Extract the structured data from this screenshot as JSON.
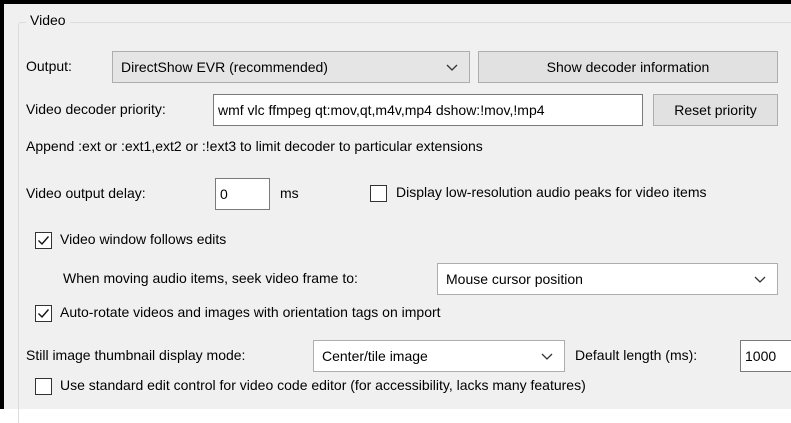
{
  "group": {
    "title": "Video"
  },
  "output": {
    "label": "Output:",
    "selected": "DirectShow EVR (recommended)",
    "decoder_button": "Show decoder information"
  },
  "decoder_priority": {
    "label": "Video decoder priority:",
    "value": "wmf vlc ffmpeg qt:mov,qt,m4v,mp4 dshow:!mov,!mp4",
    "reset_button": "Reset priority",
    "hint": "Append :ext or :ext1,ext2 or :!ext3 to limit decoder to particular extensions"
  },
  "output_delay": {
    "label": "Video output delay:",
    "value": "0",
    "unit": "ms"
  },
  "low_res_peaks": {
    "label": "Display low-resolution audio peaks for video items",
    "checked": false
  },
  "follows_edits": {
    "label": "Video window follows edits",
    "checked": true
  },
  "seek": {
    "label": "When moving audio items, seek video frame to:",
    "selected": "Mouse cursor position"
  },
  "auto_rotate": {
    "label": "Auto-rotate videos and images with orientation tags on import",
    "checked": true
  },
  "thumbnail": {
    "label": "Still image thumbnail display mode:",
    "selected": "Center/tile image",
    "default_length_label": "Default length (ms):",
    "default_length_value": "1000"
  },
  "standard_edit": {
    "label": "Use standard edit control for video code editor (for accessibility, lacks many features)",
    "checked": false
  },
  "icons": {
    "dropdown": "chevron-down-icon",
    "check": "checkmark-icon"
  }
}
